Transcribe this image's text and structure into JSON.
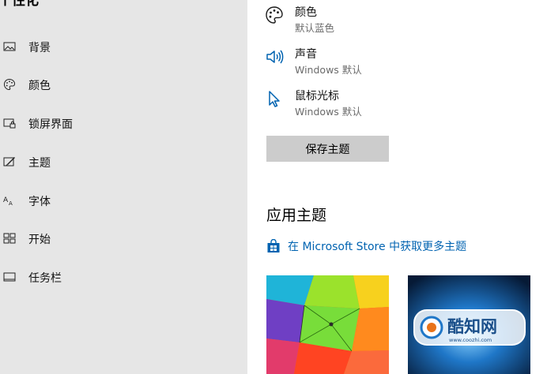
{
  "sidebar": {
    "title": "个性化",
    "items": [
      {
        "label": "背景",
        "icon": "picture-icon"
      },
      {
        "label": "颜色",
        "icon": "palette-icon"
      },
      {
        "label": "锁屏界面",
        "icon": "lock-screen-icon"
      },
      {
        "label": "主题",
        "icon": "theme-brush-icon"
      },
      {
        "label": "字体",
        "icon": "font-icon"
      },
      {
        "label": "开始",
        "icon": "start-tiles-icon"
      },
      {
        "label": "任务栏",
        "icon": "taskbar-icon"
      }
    ]
  },
  "main": {
    "settings": [
      {
        "title": "颜色",
        "value": "默认蓝色",
        "icon": "palette-icon"
      },
      {
        "title": "声音",
        "value": "Windows 默认",
        "icon": "speaker-icon"
      },
      {
        "title": "鼠标光标",
        "value": "Windows 默认",
        "icon": "cursor-icon"
      }
    ],
    "save_button": "保存主题",
    "apply_title": "应用主题",
    "store_link": "在 Microsoft Store 中获取更多主题",
    "themes": [
      {
        "name": "colorful-umbrellas-theme"
      },
      {
        "name": "windows-blue-theme"
      }
    ]
  },
  "watermark": {
    "brand": "酷知网",
    "url": "www.coozhi.com"
  },
  "colors": {
    "sidebar_bg": "#e6e6e6",
    "accent": "#0063b1",
    "button_bg": "#cccccc"
  }
}
